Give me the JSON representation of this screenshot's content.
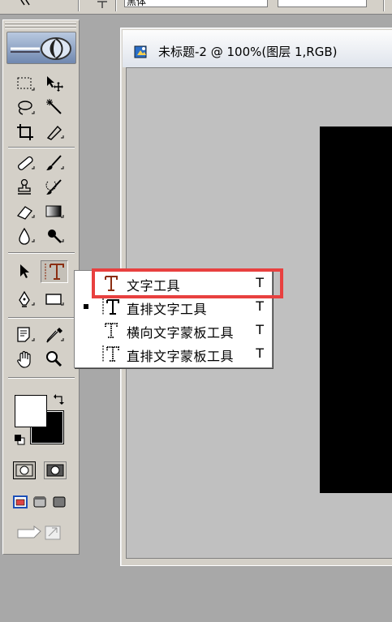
{
  "options_bar": {
    "font_family_value": "黑体"
  },
  "document": {
    "title": "未标题-2 @ 100%(图层 1,RGB)"
  },
  "toolbox": {
    "tools": [
      "marquee-icon",
      "move-icon",
      "lasso-icon",
      "magic-wand-icon",
      "crop-icon",
      "slice-icon",
      "healing-brush-icon",
      "brush-icon",
      "clone-stamp-icon",
      "history-brush-icon",
      "eraser-icon",
      "gradient-icon",
      "blur-icon",
      "dodge-icon",
      "path-selection-icon",
      "type-tool-icon",
      "pen-icon",
      "rectangle-shape-icon",
      "notes-icon",
      "eyedropper-icon",
      "hand-icon",
      "zoom-icon"
    ],
    "foreground_color": "#ffffff",
    "background_color": "#000000"
  },
  "type_flyout": {
    "items": [
      {
        "label": "文字工具",
        "shortcut": "T",
        "icon": "horizontal-type-icon",
        "selected": false
      },
      {
        "label": "直排文字工具",
        "shortcut": "T",
        "icon": "vertical-type-icon",
        "selected": true
      },
      {
        "label": "横向文字蒙板工具",
        "shortcut": "T",
        "icon": "horizontal-type-mask-icon",
        "selected": false
      },
      {
        "label": "直排文字蒙板工具",
        "shortcut": "T",
        "icon": "vertical-type-mask-icon",
        "selected": false
      }
    ],
    "highlight_color": "#e8403f",
    "icon_color": "#8b2e12"
  }
}
